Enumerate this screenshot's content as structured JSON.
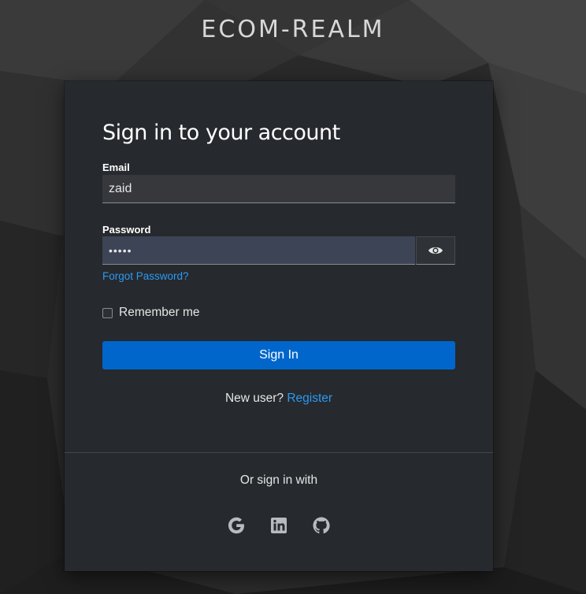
{
  "realm": {
    "title": "ECOM-REALM"
  },
  "login": {
    "heading": "Sign in to your account",
    "email_label": "Email",
    "email_value": "zaid",
    "password_label": "Password",
    "password_value": "•••••",
    "forgot_password": "Forgot Password?",
    "remember_me": "Remember me",
    "sign_in_button": "Sign In",
    "new_user_text": "New user?",
    "register_link": "Register"
  },
  "social": {
    "heading": "Or sign in with",
    "providers": [
      {
        "icon": "google-icon"
      },
      {
        "icon": "linkedin-icon"
      },
      {
        "icon": "github-icon"
      }
    ]
  },
  "colors": {
    "primary_button": "#0066cc",
    "link": "#2b9af3",
    "card_background": "#26292d",
    "page_background": "#2b2b2b"
  }
}
